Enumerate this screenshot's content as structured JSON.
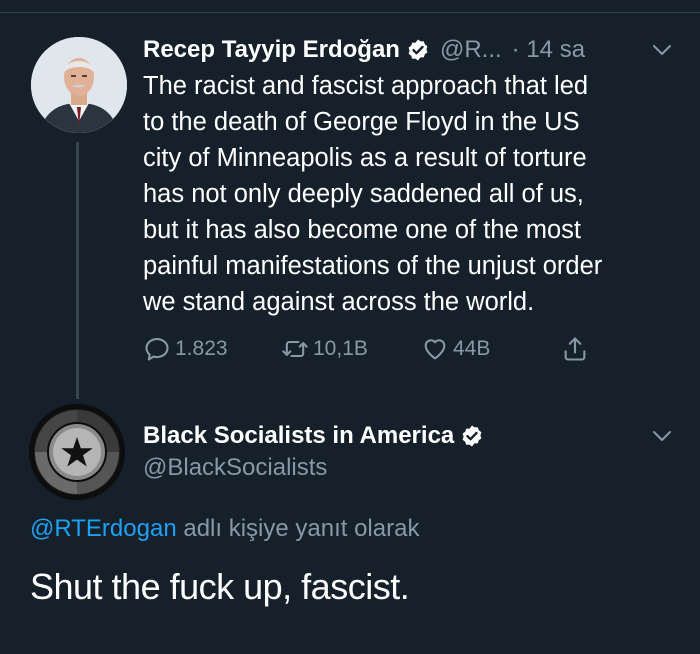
{
  "colors": {
    "background": "#15202b",
    "primary_text": "#ffffff",
    "secondary_text": "#8899a6",
    "link": "#1da1f2",
    "divider": "#38444d"
  },
  "tweet1": {
    "author_name": "Recep Tayyip Erdoğan",
    "handle_truncated": "@R...",
    "time": "· 14 sa",
    "text": "The racist and fascist approach that led to the death of George Floyd in the US city of Minneapolis as a result of torture has not only deeply saddened all of us, but it has also become one of the most painful manifestations of the unjust order we stand against across the world.",
    "text_lines": [
      "The racist and fascist approach that led",
      "to the death of George Floyd in the US",
      "city of Minneapolis as a result of torture",
      "has not only deeply saddened all of us,",
      "but it has also become one of the most",
      "painful manifestations of the unjust order",
      "we stand against across the world."
    ],
    "replies": "1.823",
    "retweets": "10,1B",
    "likes": "44B",
    "icons": [
      "verified-badge-icon",
      "chevron-down-icon",
      "reply-icon",
      "retweet-icon",
      "like-icon",
      "share-icon"
    ]
  },
  "tweet2": {
    "author_name": "Black Socialists in America",
    "handle": "@BlackSocialists",
    "reply_mention": "@RTErdogan",
    "reply_context_suffix": " adlı kişiye yanıt olarak",
    "text": "Shut the fuck up, fascist.",
    "icons": [
      "verified-badge-icon",
      "chevron-down-icon",
      "star-logo-icon"
    ]
  }
}
